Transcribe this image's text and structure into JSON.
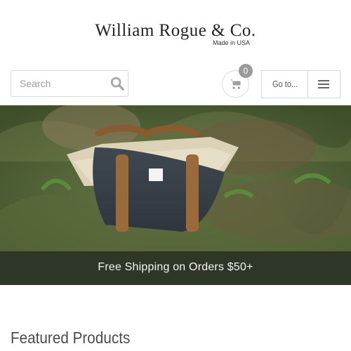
{
  "brand": {
    "name": "William Rogue & Co.",
    "tagline": "Made in USA"
  },
  "header": {
    "search_placeholder": "Search",
    "cart_count": "0",
    "goto_label": "Go to..."
  },
  "icons": {
    "search": "search-icon",
    "cart": "cart-icon",
    "menu": "menu-icon"
  },
  "hero": {
    "image_label": "Waxed canvas duffel bag on grass"
  },
  "banner": {
    "text": "Free Shipping on Orders $50+"
  },
  "section": {
    "featured_title": "Featured Products"
  },
  "colors": {
    "banner_bg": "#2e3727",
    "badge_bg": "#9b9b9b"
  }
}
